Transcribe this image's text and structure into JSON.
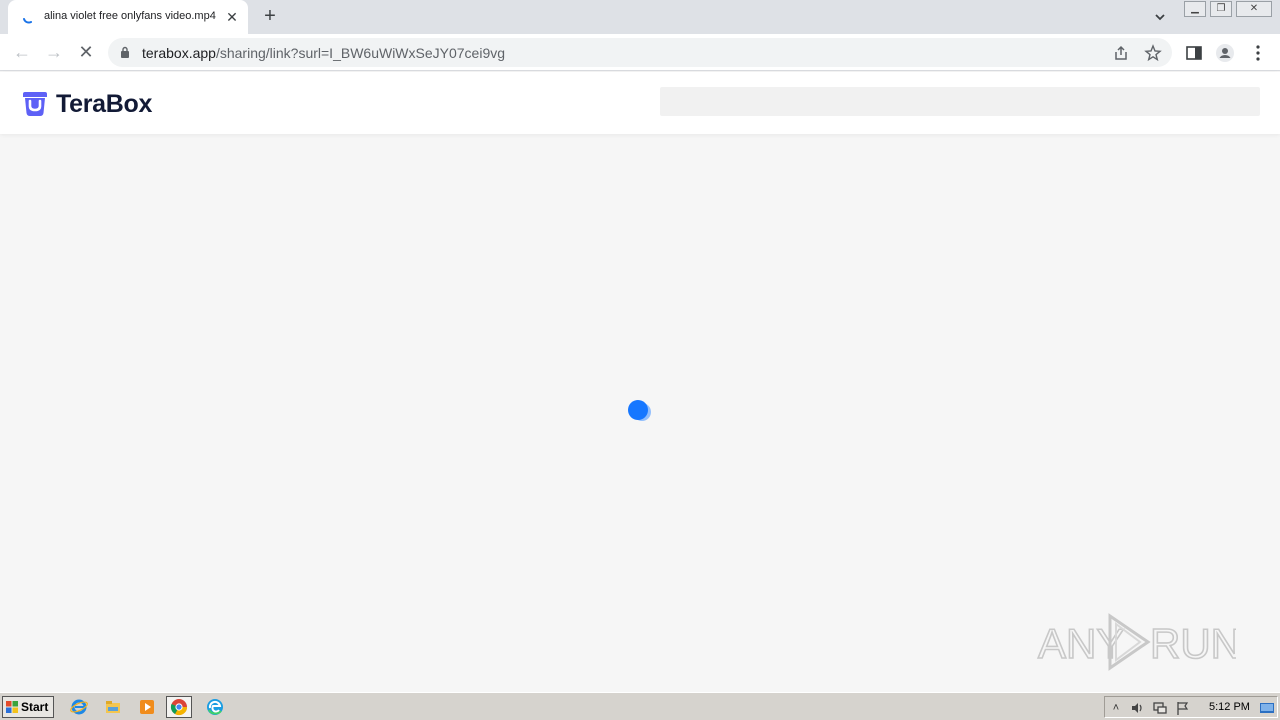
{
  "browser": {
    "tab": {
      "title": "alina violet free onlyfans video.mp4",
      "close_glyph": "✕"
    },
    "new_tab_glyph": "+",
    "window_controls": {
      "minimize": "▁",
      "restore": "❐",
      "close": "✕"
    },
    "nav": {
      "back": "←",
      "forward": "→",
      "stop": "✕"
    },
    "url": {
      "domain": "terabox.app",
      "path": "/sharing/link?surl=I_BW6uWiWxSeJY07cei9vg"
    },
    "icons": [
      "lock-icon",
      "share-icon",
      "star-icon",
      "side-panel-icon",
      "profile-icon",
      "menu-icon"
    ]
  },
  "page": {
    "brand": "TeraBox",
    "brand_color": "#5e61f6",
    "loader_color": "#1677ff"
  },
  "watermark": {
    "text_left": "ANY",
    "text_right": "RUN"
  },
  "taskbar": {
    "start_label": "Start",
    "apps": [
      "ie-icon",
      "explorer-icon",
      "media-player-icon",
      "chrome-icon",
      "edge-icon"
    ],
    "clock": "5:12 PM"
  }
}
